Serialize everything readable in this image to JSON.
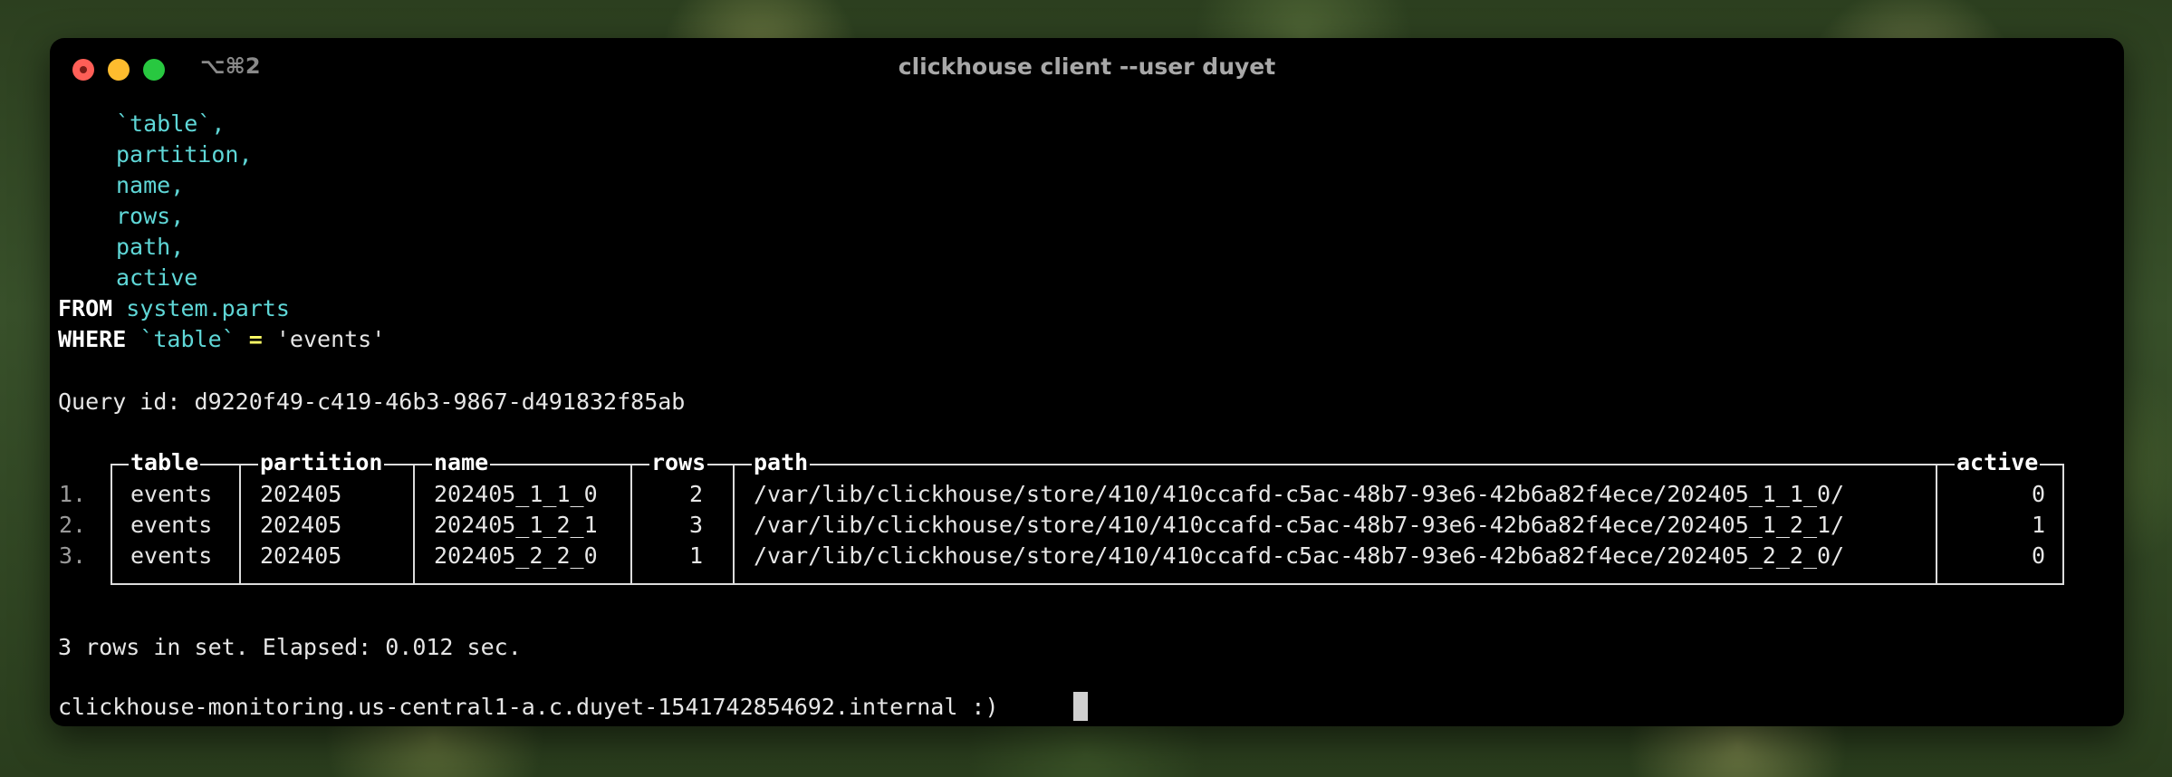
{
  "window": {
    "title": "clickhouse client --user duyet",
    "tab_shortcut": "⌥⌘2"
  },
  "query": {
    "select_items": [
      "`table`,",
      "partition,",
      "name,",
      "rows,",
      "path,",
      "active"
    ],
    "from_keyword": "FROM",
    "from_target": "system.parts",
    "where_keyword": "WHERE",
    "where_column": "`table`",
    "where_operator": "=",
    "where_value": "'events'"
  },
  "query_id_line": "Query id: d9220f49-c419-46b3-9867-d491832f85ab",
  "result_table": {
    "columns": [
      "table",
      "partition",
      "name",
      "rows",
      "path",
      "active"
    ],
    "rows": [
      {
        "num": "1.",
        "table": "events",
        "partition": "202405",
        "name": "202405_1_1_0",
        "rows": "2",
        "path": "/var/lib/clickhouse/store/410/410ccafd-c5ac-48b7-93e6-42b6a82f4ece/202405_1_1_0/",
        "active": "0"
      },
      {
        "num": "2.",
        "table": "events",
        "partition": "202405",
        "name": "202405_1_2_1",
        "rows": "3",
        "path": "/var/lib/clickhouse/store/410/410ccafd-c5ac-48b7-93e6-42b6a82f4ece/202405_1_2_1/",
        "active": "1"
      },
      {
        "num": "3.",
        "table": "events",
        "partition": "202405",
        "name": "202405_2_2_0",
        "rows": "1",
        "path": "/var/lib/clickhouse/store/410/410ccafd-c5ac-48b7-93e6-42b6a82f4ece/202405_2_2_0/",
        "active": "0"
      }
    ]
  },
  "summary_line": "3 rows in set. Elapsed: 0.012 sec.",
  "prompt_line": "clickhouse-monitoring.us-central1-a.c.duyet-1541742854692.internal :)",
  "colors": {
    "identifier": "#5fd7d7",
    "keyword": "#ffffff",
    "operator": "#ffff66",
    "terminal_bg": "#000000",
    "close": "#ff5f57",
    "minimize": "#febc2e",
    "zoom": "#28c840"
  },
  "icons": {
    "close": "close-icon",
    "minimize": "minimize-icon",
    "zoom": "zoom-icon"
  }
}
